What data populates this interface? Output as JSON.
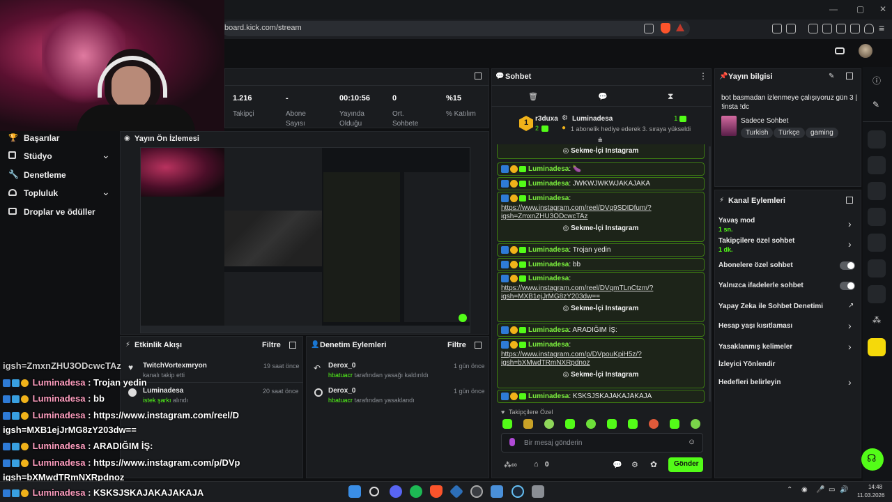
{
  "browser": {
    "url": "board.kick.com/stream",
    "window_controls": [
      "—",
      "▢",
      "✕"
    ]
  },
  "stats": [
    {
      "value": "1.216",
      "label": "Takipçi"
    },
    {
      "value": "-",
      "label": "Abone\nSayısı"
    },
    {
      "value": "00:10:56",
      "label": "Yayında\nOlduğu"
    },
    {
      "value": "0",
      "label": "Ort.\nSohbete"
    },
    {
      "value": "%15",
      "label": "% Katılım"
    }
  ],
  "sidebar": {
    "items": [
      {
        "label": "Başarılar",
        "icon": "trophy-icon",
        "expand": false
      },
      {
        "label": "Stüdyo",
        "icon": "studio-icon",
        "expand": true
      },
      {
        "label": "Denetleme",
        "icon": "wrench-icon",
        "expand": false
      },
      {
        "label": "Topluluk",
        "icon": "community-icon",
        "expand": true
      },
      {
        "label": "Droplar ve ödüller",
        "icon": "drops-icon",
        "expand": false
      }
    ]
  },
  "preview": {
    "title": "Yayın Ön İzlemesi"
  },
  "activity": {
    "title": "Etkinlik Akışı",
    "filter": "Filtre",
    "items": [
      {
        "user": "TwitchVortexmryon",
        "desc": "kanalı takip etti",
        "time": "19 saat önce"
      },
      {
        "user": "Luminadesa",
        "desc_highlight": "istek şarkı",
        "desc": " alındı",
        "time": "20 saat önce"
      }
    ]
  },
  "moderation": {
    "title": "Denetim Eylemleri",
    "filter": "Filtre",
    "items": [
      {
        "user": "Derox_0",
        "actor": "hbatuacr",
        "desc": " tarafından yasağı kaldırıldı",
        "time": "1 gün önce"
      },
      {
        "user": "Derox_0",
        "actor": "hbatuacr",
        "desc": " tarafından yasaklandı",
        "time": "1 gün önce"
      }
    ]
  },
  "chat": {
    "title": "Sohbet",
    "top_user": "r3duxa",
    "top_count": "2",
    "top_rank": "1",
    "pinned_user": "Luminadesa",
    "pinned_count": "1",
    "pinned_text": "1 abonelik hediye ederek 3. sıraya yükseldi",
    "ig_button": "Sekme-İçi Instagram",
    "messages": [
      {
        "name": "Luminadesa",
        "text": "🍆"
      },
      {
        "name": "Luminadesa",
        "text": "JWKWJWKWJAKAJAKA"
      },
      {
        "name": "Luminadesa",
        "link1": "https://www.instagram.com/reel/DVq9SDIDfum/?",
        "link2": "igsh=ZmxnZHU3ODcwcTAz"
      },
      {
        "name": "Luminadesa",
        "text": "Trojan yedin"
      },
      {
        "name": "Luminadesa",
        "text": "bb"
      },
      {
        "name": "Luminadesa",
        "link1": "https://www.instagram.com/reel/DVqmTLnCtzm/?",
        "link2": "igsh=MXB1ejJrMG8zY203dw=="
      },
      {
        "name": "Luminadesa",
        "text": "ARADIĞIM İŞ:"
      },
      {
        "name": "Luminadesa",
        "link1": "https://www.instagram.com/p/DVpouKpiH5z/?",
        "link2": "igsh=bXMwdTRmNXRpdnoz"
      },
      {
        "name": "Luminadesa",
        "text": "KSKSJSKAJAKAJAKAJA"
      }
    ],
    "followers_only": "Takipçilere Özel",
    "input_placeholder": "Bir mesaj gönderin",
    "points": "0",
    "send": "Gönder"
  },
  "stream_info": {
    "title": "Yayın bilgisi",
    "stream_title": "bot basmadan izlenmeye çalışıyoruz gün 3 | !insta !dc",
    "category": "Sadece Sohbet",
    "tags": [
      "Turkish",
      "Türkçe",
      "gaming"
    ]
  },
  "channel_actions": {
    "title": "Kanal Eylemleri",
    "items": [
      {
        "label": "Yavaş mod",
        "sub": "1 sn.",
        "control": "chevron"
      },
      {
        "label": "Takipçilere özel sohbet",
        "sub": "1 dk.",
        "control": "chevron"
      },
      {
        "label": "Abonelere özel sohbet",
        "sub": "",
        "control": "toggle"
      },
      {
        "label": "Yalnızca ifadelerle sohbet",
        "sub": "",
        "control": "toggle"
      },
      {
        "label": "Yapay Zeka ile Sohbet Denetimi",
        "sub": "",
        "control": "external"
      },
      {
        "label": "Hesap yaşı kısıtlaması",
        "sub": "",
        "control": "chevron"
      },
      {
        "label": "Yasaklanmış kelimeler",
        "sub": "",
        "control": "chevron"
      },
      {
        "label": "İzleyici Yönlendir",
        "sub": "",
        "control": "none"
      },
      {
        "label": "Hedefleri belirleyin",
        "sub": "",
        "control": "chevron"
      }
    ]
  },
  "overlay_chat": [
    {
      "prefix": "",
      "name": "",
      "text": "igsh=ZmxnZHU3ODcwcTAz"
    },
    {
      "prefix": "badges",
      "name": "Luminadesa",
      "text": " : Trojan yedin"
    },
    {
      "prefix": "badges",
      "name": "Luminadesa",
      "text": " : bb"
    },
    {
      "prefix": "badges",
      "name": "Luminadesa",
      "text": " : https://www.instagram.com/reel/D"
    },
    {
      "prefix": "",
      "name": "",
      "text": "igsh=MXB1ejJrMG8zY203dw=="
    },
    {
      "prefix": "badges",
      "name": "Luminadesa",
      "text": " : ARADIĞIM İŞ:"
    },
    {
      "prefix": "badges",
      "name": "Luminadesa",
      "text": " : https://www.instagram.com/p/DVp"
    },
    {
      "prefix": "",
      "name": "",
      "text": "igsh=bXMwdTRmNXRpdnoz"
    },
    {
      "prefix": "badges",
      "name": "Luminadesa",
      "text": " : KSKSJSKAJAKAJAKAJA"
    }
  ],
  "taskbar": {
    "time": "14:48",
    "date": "11.03.2026"
  },
  "colors": {
    "accent": "#53fc18",
    "panel": "#1a1c1f",
    "background": "#0f1012"
  }
}
